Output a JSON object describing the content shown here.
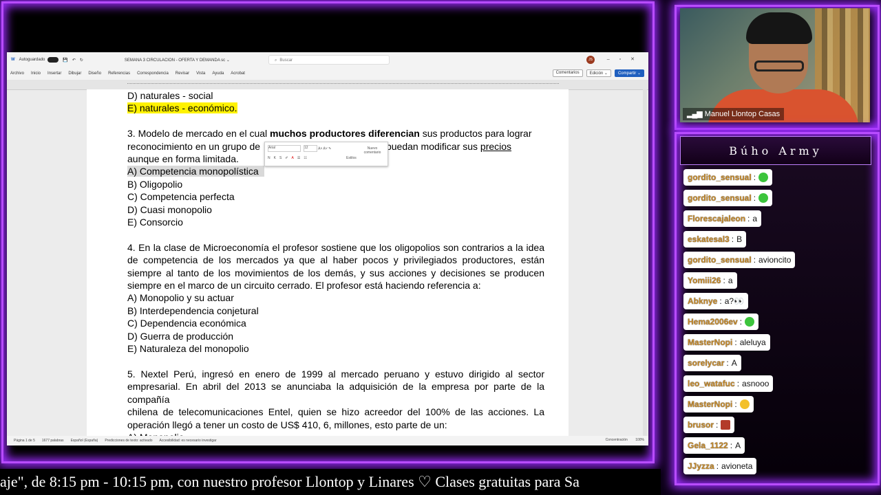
{
  "word": {
    "autosave_label": "Autoguardado",
    "doc_title": "SEMANA 3 CIRCULACION - OFERTA Y DEMANDA sc ⌄",
    "search_placeholder": "Buscar",
    "user_initials": "JS",
    "menu": [
      "Archivo",
      "Inicio",
      "Insertar",
      "Dibujar",
      "Diseño",
      "Referencias",
      "Correspondencia",
      "Revisar",
      "Vista",
      "Ayuda",
      "Acrobat"
    ],
    "comments_label": "Comentarios",
    "edit_label": "Edición ⌄",
    "share_label": "Compartir ⌄",
    "mini_toolbar": {
      "font": "Arial",
      "size": "12",
      "styles_label": "Estilos",
      "new_comment_label": "Nuevo comentario"
    },
    "status": {
      "page": "Página 1 de 5",
      "words": "1677 palabras",
      "language": "Español (España)",
      "predictions": "Predicciones de texto: activado",
      "accessibility": "Accesibilidad: es necesario investigar",
      "focus": "Concentración",
      "zoom": "100%"
    }
  },
  "document": {
    "prev_option_d": "D) naturales - social",
    "prev_option_e": "E) naturales - económico.",
    "q3_line1_a": "3. Modelo de mercado en el cual ",
    "q3_line1_b": "muchos productores diferencian",
    "q3_line1_c": " sus productos para lograr",
    "q3_line2_a": "reconocimiento en un grupo de",
    "q3_line2_b": "e que puedan modificar sus ",
    "q3_line2_c": "precios",
    "q3_line3": "aunque en forma limitada.",
    "q3_options": [
      "A) Competencia monopolística",
      "B) Oligopolio",
      "C) Competencia perfecta",
      "D) Cuasi monopolio",
      "E) Consorcio"
    ],
    "q4_lines": [
      "4. En la clase de Microeconomía el profesor sostiene que los oligopolios son contrarios a la idea",
      "de competencia de los mercados ya que al haber pocos y privilegiados productores, están",
      "siempre al tanto de los movimientos de los demás, y sus acciones y decisiones se producen"
    ],
    "q4_last": "siempre en el marco de un circuito cerrado. El profesor está haciendo referencia a:",
    "q4_options": [
      "A) Monopolio y su actuar",
      "B) Interdependencia conjetural",
      "C) Dependencia económica",
      "D) Guerra de producción",
      "E) Naturaleza del monopolio"
    ],
    "q5_lines": [
      "5. Nextel Perú, ingresó en enero de 1999 al mercado peruano y estuvo dirigido al sector",
      "empresarial. En abril del 2013 se anunciaba la adquisición de la empresa por parte de la compañía",
      "chilena de telecomunicaciones Entel, quien se hizo acreedor del 100% de las acciones. La"
    ],
    "q5_last": "operación llegó a tener un costo de US$ 410, 6, millones, esto parte de un:",
    "q5_option_a": "A) Monopolio"
  },
  "camera": {
    "name": "Manuel Llontop Casas"
  },
  "chat": {
    "title": "Búho Army",
    "messages": [
      {
        "user": "gordito_sensual",
        "text": "",
        "emote": "green"
      },
      {
        "user": "gordito_sensual",
        "text": "",
        "emote": "green"
      },
      {
        "user": "Florescajaleon",
        "text": "a",
        "emote": ""
      },
      {
        "user": "eskatesal3",
        "text": "B",
        "emote": ""
      },
      {
        "user": "gordito_sensual",
        "text": "avioncito",
        "emote": ""
      },
      {
        "user": "Yomiii26",
        "text": "a",
        "emote": ""
      },
      {
        "user": "Abknye",
        "text": "a?👀",
        "emote": ""
      },
      {
        "user": "Hema2006ev",
        "text": "",
        "emote": "green"
      },
      {
        "user": "MasterNopi",
        "text": "aleluya",
        "emote": ""
      },
      {
        "user": "sorelycar",
        "text": "A",
        "emote": ""
      },
      {
        "user": "leo_watafuc",
        "text": "asnooo",
        "emote": ""
      },
      {
        "user": "MasterNopi",
        "text": "",
        "emote": "yellow"
      },
      {
        "user": "brusor",
        "text": "",
        "emote": "red"
      },
      {
        "user": "Gela_1122",
        "text": "A",
        "emote": ""
      },
      {
        "user": "JJyzza",
        "text": "avioneta",
        "emote": ""
      }
    ]
  },
  "ticker": {
    "text": "aje\", de 8:15 pm - 10:15 pm, con nuestro profesor Llontop y Linares ♡     Clases gratuitas para Sa"
  }
}
